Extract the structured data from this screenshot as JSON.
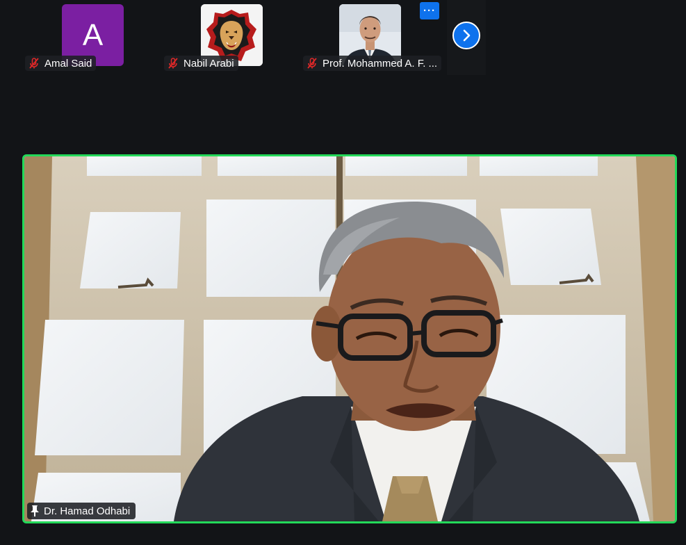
{
  "participants": [
    {
      "name": "Amal Said",
      "avatar_type": "letter",
      "avatar_letter": "A",
      "avatar_color": "#7b1fa2",
      "muted": true
    },
    {
      "name": "Nabil Arabi",
      "avatar_type": "image",
      "avatar_image": "lion-logo",
      "muted": true
    },
    {
      "name": "Prof. Mohammed A. F. ...",
      "avatar_type": "image",
      "avatar_image": "profile-photo",
      "muted": true
    }
  ],
  "controls": {
    "more_label": "···",
    "next_icon": "chevron-right-icon"
  },
  "speaker": {
    "name": "Dr. Hamad Odhabi",
    "pinned": true,
    "active_border_color": "#23d959"
  },
  "colors": {
    "background": "#121417",
    "accent_blue": "#0e72ed",
    "muted_red": "#e02828"
  }
}
